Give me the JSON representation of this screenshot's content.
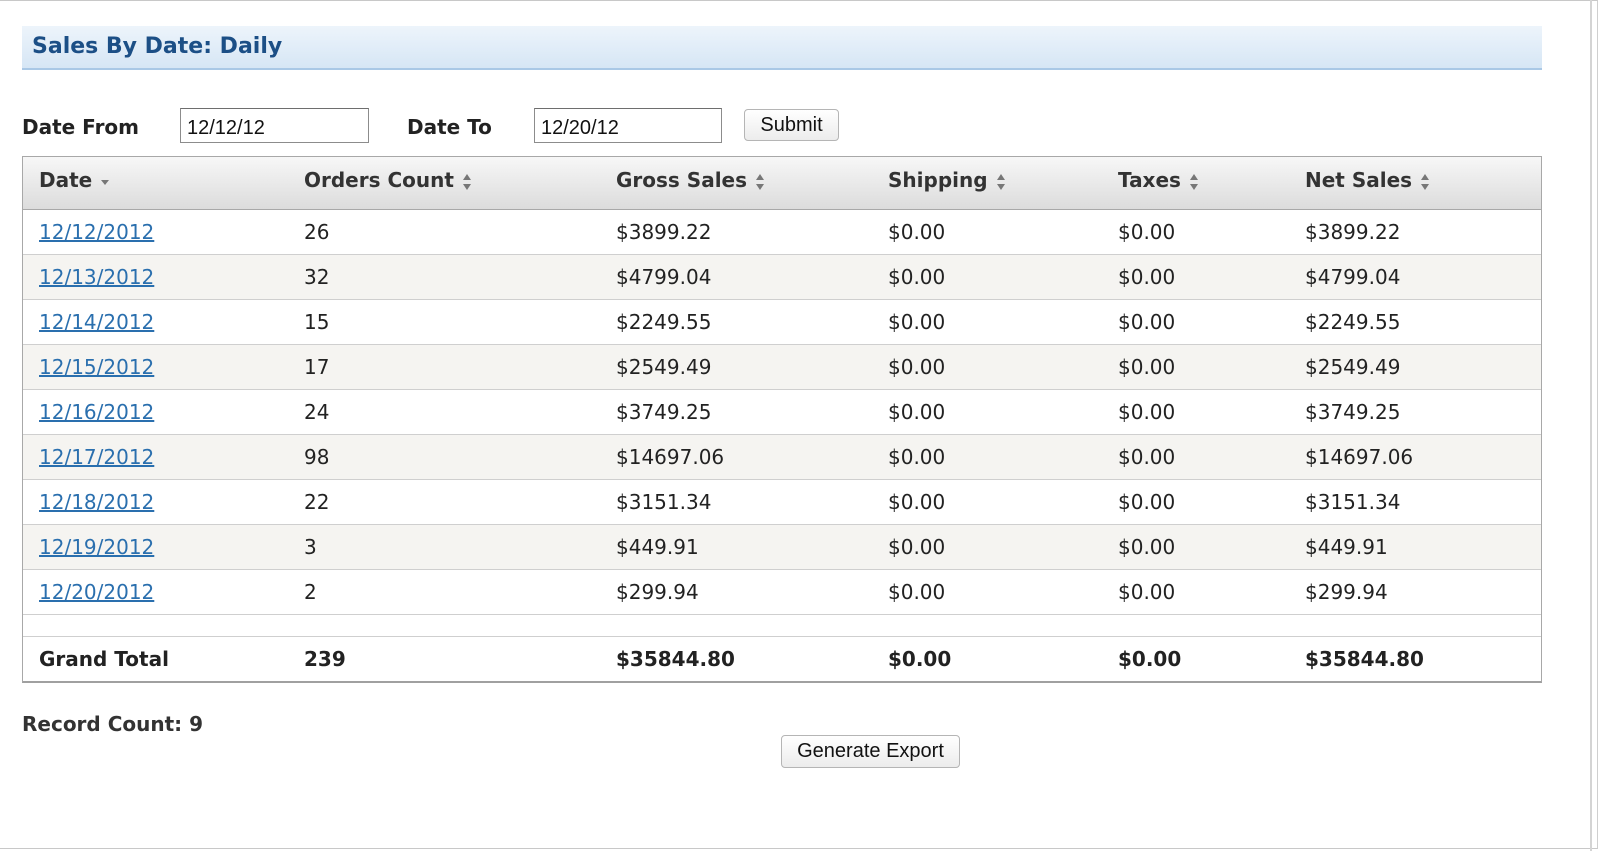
{
  "page": {
    "title": "Sales By Date: Daily"
  },
  "filters": {
    "date_from_label": "Date From",
    "date_from_value": "12/12/12",
    "date_to_label": "Date To",
    "date_to_value": "12/20/12",
    "submit_label": "Submit"
  },
  "table": {
    "columns": [
      "Date",
      "Orders Count",
      "Gross Sales",
      "Shipping",
      "Taxes",
      "Net Sales"
    ],
    "sorted_column": "Date",
    "rows": [
      {
        "date": "12/12/2012",
        "orders": "26",
        "gross": "$3899.22",
        "shipping": "$0.00",
        "taxes": "$0.00",
        "net": "$3899.22"
      },
      {
        "date": "12/13/2012",
        "orders": "32",
        "gross": "$4799.04",
        "shipping": "$0.00",
        "taxes": "$0.00",
        "net": "$4799.04"
      },
      {
        "date": "12/14/2012",
        "orders": "15",
        "gross": "$2249.55",
        "shipping": "$0.00",
        "taxes": "$0.00",
        "net": "$2249.55"
      },
      {
        "date": "12/15/2012",
        "orders": "17",
        "gross": "$2549.49",
        "shipping": "$0.00",
        "taxes": "$0.00",
        "net": "$2549.49"
      },
      {
        "date": "12/16/2012",
        "orders": "24",
        "gross": "$3749.25",
        "shipping": "$0.00",
        "taxes": "$0.00",
        "net": "$3749.25"
      },
      {
        "date": "12/17/2012",
        "orders": "98",
        "gross": "$14697.06",
        "shipping": "$0.00",
        "taxes": "$0.00",
        "net": "$14697.06"
      },
      {
        "date": "12/18/2012",
        "orders": "22",
        "gross": "$3151.34",
        "shipping": "$0.00",
        "taxes": "$0.00",
        "net": "$3151.34"
      },
      {
        "date": "12/19/2012",
        "orders": "3",
        "gross": "$449.91",
        "shipping": "$0.00",
        "taxes": "$0.00",
        "net": "$449.91"
      },
      {
        "date": "12/20/2012",
        "orders": "2",
        "gross": "$299.94",
        "shipping": "$0.00",
        "taxes": "$0.00",
        "net": "$299.94"
      }
    ],
    "total": {
      "label": "Grand Total",
      "orders": "239",
      "gross": "$35844.80",
      "shipping": "$0.00",
      "taxes": "$0.00",
      "net": "$35844.80"
    }
  },
  "footer": {
    "record_count": "Record Count: 9",
    "export_label": "Generate Export"
  },
  "icons": {
    "sort_desc": "sort-desc-icon",
    "sort_both": "sort-both-icon"
  },
  "colors": {
    "title": "#1c4f86",
    "link": "#2a6fae",
    "alt_row": "#f5f4f1"
  }
}
